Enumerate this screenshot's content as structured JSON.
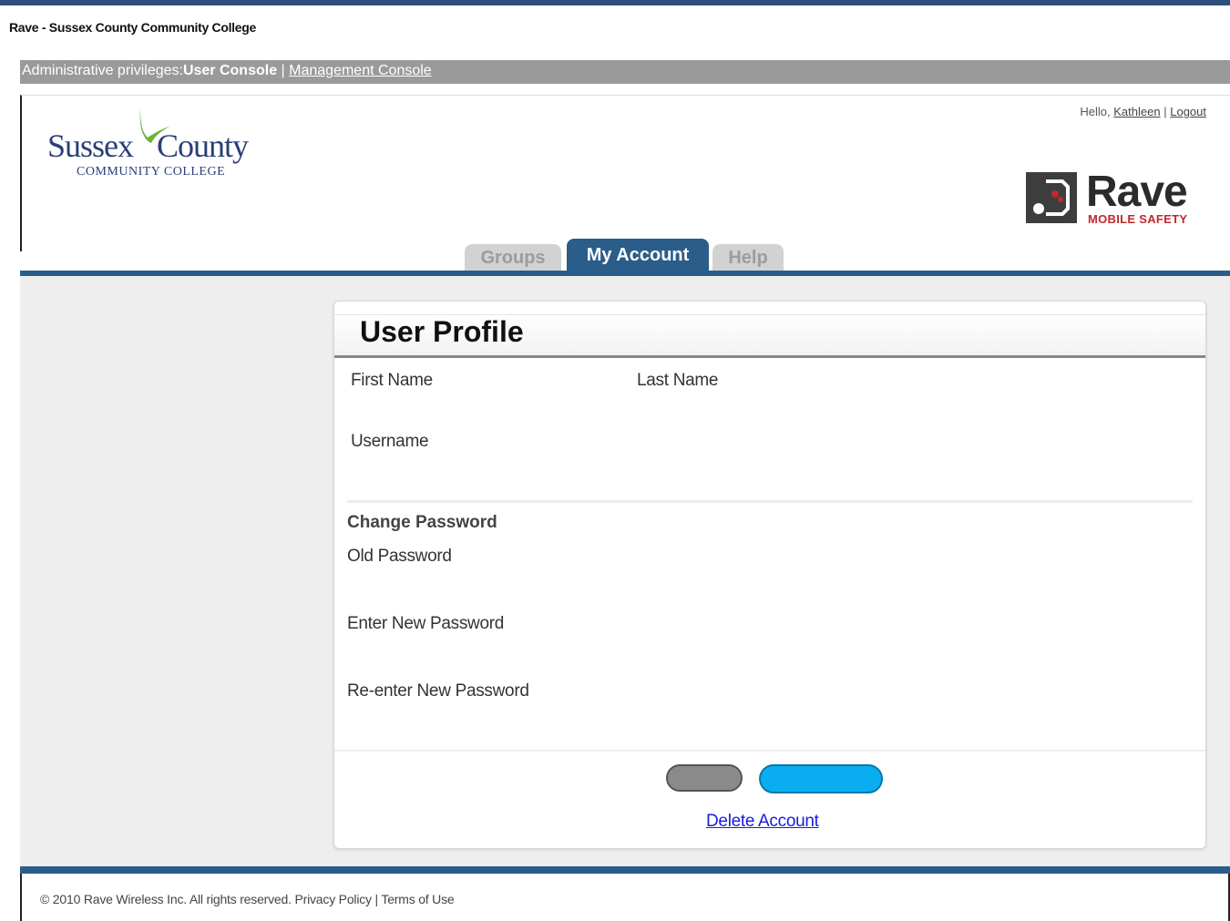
{
  "window": {
    "title": "Rave - Sussex County Community College"
  },
  "admin_bar": {
    "label": "Administrative privileges:",
    "current": "User Console",
    "separator": "|",
    "management_link": "Management Console"
  },
  "header": {
    "logo": {
      "word1": "Sussex",
      "word2": "County",
      "sub": "COMMUNITY COLLEGE"
    },
    "greeting": "Hello,",
    "user_name": "Kathleen",
    "separator": "|",
    "logout": "Logout",
    "rave_logo": {
      "word": "Rave",
      "sub": "MOBILE SAFETY"
    }
  },
  "tabs": [
    {
      "label": "Groups",
      "active": false
    },
    {
      "label": "My Account",
      "active": true
    },
    {
      "label": "Help",
      "active": false
    }
  ],
  "profile": {
    "title": "User Profile",
    "first_name_label": "First Name",
    "last_name_label": "Last Name",
    "username_label": "Username",
    "change_password_heading": "Change Password",
    "old_password_label": "Old Password",
    "new_password_label": "Enter New Password",
    "reenter_password_label": "Re-enter New Password",
    "delete_account_link": "Delete Account"
  },
  "footer": {
    "copyright": "© 2010 Rave Wireless Inc. All rights reserved.",
    "privacy": "Privacy Policy",
    "separator": "|",
    "terms": "Terms of Use"
  },
  "colors": {
    "accent_blue": "#2a5d8a",
    "button_blue": "#0aaef0",
    "button_gray": "#8a8a8a",
    "admin_bar": "#9a9a9a",
    "rave_red": "#c0282d"
  }
}
